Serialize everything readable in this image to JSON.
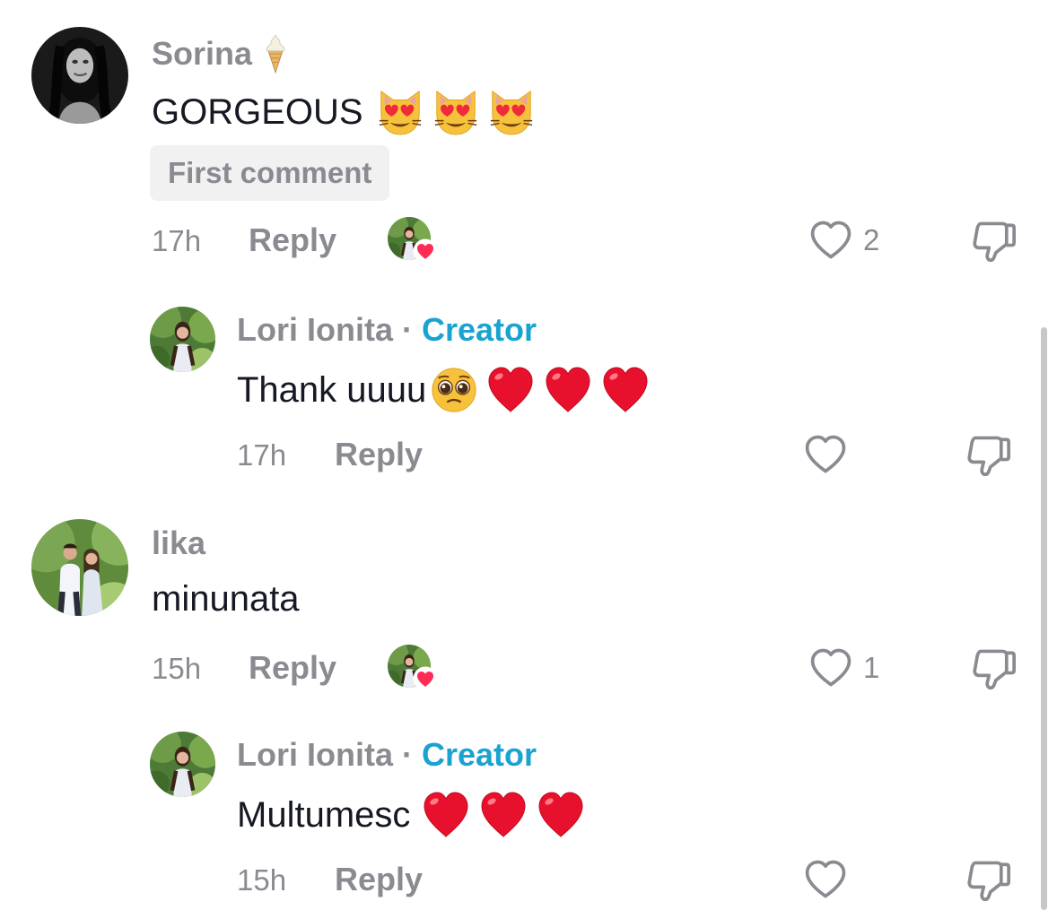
{
  "comments": [
    {
      "author": "Sorina",
      "text": "GORGEOUS",
      "emojis": [
        "smiling-cat-heart-eyes",
        "smiling-cat-heart-eyes",
        "smiling-cat-heart-eyes"
      ],
      "badge": "First comment",
      "time": "17h",
      "reply_label": "Reply",
      "likes": "2"
    },
    {
      "author": "Lori Ionita",
      "separator": "·",
      "creator_label": "Creator",
      "text": "Thank uuuu",
      "emojis": [
        "pleading-face",
        "red-heart",
        "red-heart",
        "red-heart"
      ],
      "time": "17h",
      "reply_label": "Reply"
    },
    {
      "author": "lika",
      "text": "minunata",
      "time": "15h",
      "reply_label": "Reply",
      "likes": "1"
    },
    {
      "author": "Lori Ionita",
      "separator": "·",
      "creator_label": "Creator",
      "text": "Multumesc",
      "emojis": [
        "red-heart",
        "red-heart",
        "red-heart"
      ],
      "time": "15h",
      "reply_label": "Reply"
    }
  ],
  "author_name_icon": "soft-ice-cream",
  "colors": {
    "creator": "#1aa3d1",
    "muted": "#8a8b91",
    "like_heart": "#fe2c55",
    "badge_bg": "#f1f1f2"
  }
}
